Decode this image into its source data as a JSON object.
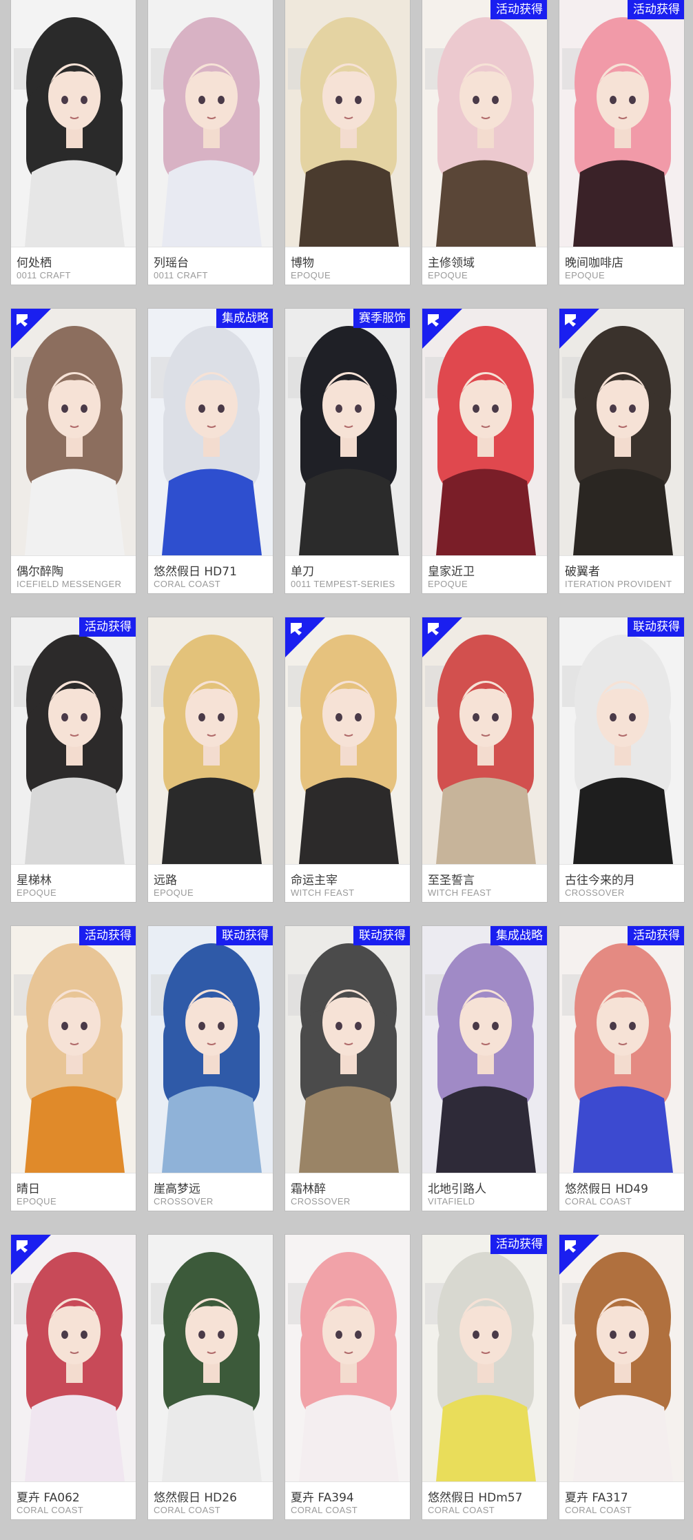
{
  "colors": {
    "page_background": "#c9c9c9",
    "card_background": "#ffffff",
    "tag_background": "#1a1ff0",
    "name_text": "#3a3a3a",
    "series_text": "#9a9a9a"
  },
  "cards": [
    {
      "name": "何处栖",
      "series": "0011 CRAFT",
      "tag": "",
      "corner_badge": false,
      "hair": "#2a2a2a",
      "clothes": "#e6e6e6",
      "bg": "#f3f3f3"
    },
    {
      "name": "列瑶台",
      "series": "0011 CRAFT",
      "tag": "",
      "corner_badge": false,
      "hair": "#d8b2c4",
      "clothes": "#e8eaf2",
      "bg": "#f2f2f2"
    },
    {
      "name": "博物",
      "series": "EPOQUE",
      "tag": "",
      "corner_badge": false,
      "hair": "#e4d3a2",
      "clothes": "#4a3b2e",
      "bg": "#efe8dc"
    },
    {
      "name": "主修领域",
      "series": "EPOQUE",
      "tag": "活动获得",
      "corner_badge": false,
      "hair": "#ecc9cf",
      "clothes": "#5a4637",
      "bg": "#f5f1ec"
    },
    {
      "name": "晚间咖啡店",
      "series": "EPOQUE",
      "tag": "活动获得",
      "corner_badge": false,
      "hair": "#f19aa8",
      "clothes": "#3a2228",
      "bg": "#f5eff0"
    },
    {
      "name": "偶尔醉陶",
      "series": "ICEFIELD MESSENGER",
      "tag": "",
      "corner_badge": true,
      "hair": "#8c6e5e",
      "clothes": "#f1f1f1",
      "bg": "#efece8"
    },
    {
      "name": "悠然假日 HD71",
      "series": "CORAL COAST",
      "tag": "集成战略",
      "corner_badge": false,
      "hair": "#dcdfe6",
      "clothes": "#2e4fcf",
      "bg": "#eef1f6"
    },
    {
      "name": "单刀",
      "series": "0011 TEMPEST-SERIES",
      "tag": "赛季服饰",
      "corner_badge": false,
      "hair": "#1f2026",
      "clothes": "#2b2b2b",
      "bg": "#ececec"
    },
    {
      "name": "皇家近卫",
      "series": "EPOQUE",
      "tag": "",
      "corner_badge": true,
      "hair": "#e0484e",
      "clothes": "#7a1e28",
      "bg": "#f1ecec"
    },
    {
      "name": "破翼者",
      "series": "ITERATION PROVIDENT",
      "tag": "",
      "corner_badge": true,
      "hair": "#3a322c",
      "clothes": "#2a2622",
      "bg": "#eceae6"
    },
    {
      "name": "星梯林",
      "series": "EPOQUE",
      "tag": "活动获得",
      "corner_badge": false,
      "hair": "#2c2a2a",
      "clothes": "#d8d8d8",
      "bg": "#f0f0f0"
    },
    {
      "name": "远路",
      "series": "EPOQUE",
      "tag": "",
      "corner_badge": false,
      "hair": "#e3c27a",
      "clothes": "#2a2a2a",
      "bg": "#f1ede6"
    },
    {
      "name": "命运主宰",
      "series": "WITCH FEAST",
      "tag": "",
      "corner_badge": true,
      "hair": "#e6c27e",
      "clothes": "#2c2a2a",
      "bg": "#f3f0ea"
    },
    {
      "name": "至圣誓言",
      "series": "WITCH FEAST",
      "tag": "",
      "corner_badge": true,
      "hair": "#d2504e",
      "clothes": "#c7b49a",
      "bg": "#f0ebe4"
    },
    {
      "name": "古往今来的月",
      "series": "CROSSOVER",
      "tag": "联动获得",
      "corner_badge": false,
      "hair": "#e8e8e8",
      "clothes": "#1e1e1e",
      "bg": "#f3f3f3"
    },
    {
      "name": "晴日",
      "series": "EPOQUE",
      "tag": "活动获得",
      "corner_badge": false,
      "hair": "#e8c596",
      "clothes": "#e08a2a",
      "bg": "#f5f1ea"
    },
    {
      "name": "崖高梦远",
      "series": "CROSSOVER",
      "tag": "联动获得",
      "corner_badge": false,
      "hair": "#2f5aa8",
      "clothes": "#8fb2d8",
      "bg": "#e9eef5"
    },
    {
      "name": "霜林醉",
      "series": "CROSSOVER",
      "tag": "联动获得",
      "corner_badge": false,
      "hair": "#4b4b4b",
      "clothes": "#9a8466",
      "bg": "#ecebe8"
    },
    {
      "name": "北地引路人",
      "series": "VITAFIELD",
      "tag": "集成战略",
      "corner_badge": false,
      "hair": "#a08ac6",
      "clothes": "#2e2a38",
      "bg": "#ecebf1"
    },
    {
      "name": "悠然假日 HD49",
      "series": "CORAL COAST",
      "tag": "活动获得",
      "corner_badge": false,
      "hair": "#e48a82",
      "clothes": "#3c4ad0",
      "bg": "#f5f1ef"
    },
    {
      "name": "夏卉 FA062",
      "series": "CORAL COAST",
      "tag": "",
      "corner_badge": true,
      "hair": "#c84a58",
      "clothes": "#f0e6f0",
      "bg": "#f4f1f3"
    },
    {
      "name": "悠然假日 HD26",
      "series": "CORAL COAST",
      "tag": "",
      "corner_badge": false,
      "hair": "#3c5a3a",
      "clothes": "#eaeaea",
      "bg": "#f2f2f2"
    },
    {
      "name": "夏卉 FA394",
      "series": "CORAL COAST",
      "tag": "",
      "corner_badge": false,
      "hair": "#f1a2a8",
      "clothes": "#f4eef0",
      "bg": "#f6f3f3"
    },
    {
      "name": "悠然假日 HDm57",
      "series": "CORAL COAST",
      "tag": "活动获得",
      "corner_badge": false,
      "hair": "#d8d8d0",
      "clothes": "#e9dd5a",
      "bg": "#f2f1ec"
    },
    {
      "name": "夏卉 FA317",
      "series": "CORAL COAST",
      "tag": "",
      "corner_badge": true,
      "hair": "#b0703e",
      "clothes": "#f4eeee",
      "bg": "#f5f1ee"
    }
  ]
}
